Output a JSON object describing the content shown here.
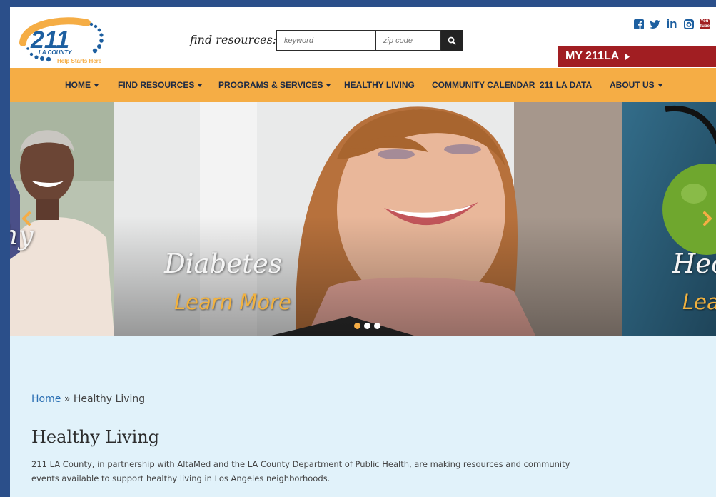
{
  "header": {
    "logo_number": "211",
    "logo_county": "LA COUNTY",
    "logo_tagline": "Help Starts Here",
    "find_label": "find resources:",
    "keyword_placeholder": "keyword",
    "zip_placeholder": "zip code",
    "social_icons": [
      "facebook-icon",
      "twitter-icon",
      "linkedin-icon",
      "instagram-icon",
      "youtube-icon"
    ],
    "social_linkedin_text": "in",
    "social_youtube_text": "You Tube",
    "my_account_label": "MY 211LA"
  },
  "nav": {
    "items": [
      {
        "label": "HOME",
        "dropdown": true
      },
      {
        "label": "FIND RESOURCES",
        "dropdown": true
      },
      {
        "label": "PROGRAMS & SERVICES",
        "dropdown": true
      },
      {
        "label": "HEALTHY LIVING",
        "dropdown": false
      },
      {
        "label": "COMMUNITY CALENDAR",
        "dropdown": false
      },
      {
        "label": "211 LA DATA",
        "dropdown": false
      },
      {
        "label": "ABOUT US",
        "dropdown": true
      }
    ]
  },
  "slider": {
    "left_fragment": "hy",
    "main_title": "Diabetes",
    "main_link": "Learn More",
    "right_title_fragment": "Hec",
    "right_link_fragment": "Lea",
    "dot_count": 3,
    "active_dot": 1
  },
  "content": {
    "breadcrumb_home": "Home",
    "breadcrumb_separator": "»",
    "breadcrumb_current": "Healthy Living",
    "title": "Healthy Living",
    "intro": "211 LA County, in partnership with AltaMed and the LA County Department of Public Health, are making resources and community events available to support healthy living in Los Angeles neighborhoods."
  },
  "colors": {
    "nav_bg": "#f5ad45",
    "my211_bg": "#a11e22",
    "content_bg": "#e1f2fa",
    "link": "#2a6fb3",
    "accent": "#f2b23f"
  }
}
